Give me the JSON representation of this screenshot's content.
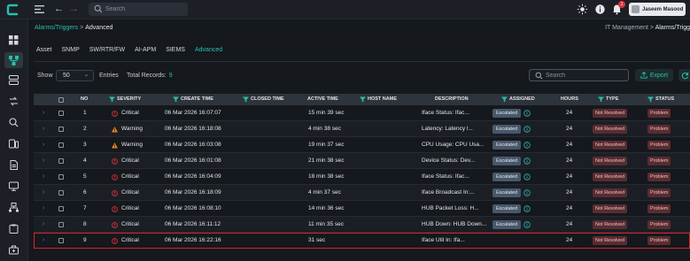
{
  "topbar": {
    "search_placeholder": "Search",
    "notification_count": "1",
    "user_name": "Jaseem Masood"
  },
  "breadcrumb": {
    "parent": "Alarms/Triggers",
    "separator": ">",
    "current": "Advanced",
    "right_prefix": "IT Management",
    "right_sep": ">",
    "right_current": "Alarms/Trigg"
  },
  "tabs": [
    {
      "label": "Asset"
    },
    {
      "label": "SNMP"
    },
    {
      "label": "SW/RTR/FW"
    },
    {
      "label": "AI-APM"
    },
    {
      "label": "SIEMS"
    },
    {
      "label": "Advanced"
    }
  ],
  "controls": {
    "show_label": "Show",
    "show_value": "50",
    "entries_label": "Entries",
    "records_label": "Total Records:",
    "records_value": "9",
    "search_placeholder": "Search",
    "export_label": "Export"
  },
  "columns": {
    "no": "NO",
    "severity": "SEVERITY",
    "create_time": "CREATE TIME",
    "closed_time": "CLOSED TIME",
    "active_time": "ACTIVE TIME",
    "host_name": "HOST NAME",
    "description": "DESCRIPTION",
    "assigned": "ASSIGNED",
    "hours": "HOURS",
    "type": "TYPE",
    "status": "STATUS"
  },
  "colors": {
    "accent": "#27c0ad",
    "critical": "#e0323a",
    "warning": "#f08a24",
    "highlight_border": "#d7232c"
  },
  "rows": [
    {
      "no": "1",
      "severity": "Critical",
      "severity_icon": "critical-circle-icon",
      "create_time": "06 Mar 2026 16:07:07",
      "closed_time": "",
      "active_time": "15 min 39 sec",
      "host_name": "",
      "description": "Iface Status: Ifac...",
      "assigned": "Escalated",
      "hours": "24",
      "type": "Not Resolved",
      "status": "Problem"
    },
    {
      "no": "2",
      "severity": "Warning",
      "severity_icon": "warning-triangle-icon",
      "create_time": "06 Mar 2026 16:18:08",
      "closed_time": "",
      "active_time": "4 min 38 sec",
      "host_name": "",
      "description": "Latency: Latency l...",
      "assigned": "Escalated",
      "hours": "24",
      "type": "Not Resolved",
      "status": "Problem"
    },
    {
      "no": "3",
      "severity": "Warning",
      "severity_icon": "warning-triangle-icon",
      "create_time": "06 Mar 2026 16:03:08",
      "closed_time": "",
      "active_time": "19 min 37 sec",
      "host_name": "",
      "description": "CPU Usage: CPU Usa...",
      "assigned": "Escalated",
      "hours": "24",
      "type": "Not Resolved",
      "status": "Problem"
    },
    {
      "no": "4",
      "severity": "Critical",
      "severity_icon": "critical-circle-icon",
      "create_time": "06 Mar 2026 16:01:08",
      "closed_time": "",
      "active_time": "21 min 38 sec",
      "host_name": "",
      "description": "Device Status: Dev...",
      "assigned": "Escalated",
      "hours": "24",
      "type": "Not Resolved",
      "status": "Problem"
    },
    {
      "no": "5",
      "severity": "Critical",
      "severity_icon": "critical-circle-icon",
      "create_time": "06 Mar 2026 16:04:09",
      "closed_time": "",
      "active_time": "18 min 38 sec",
      "host_name": "",
      "description": "Iface Status: Ifac...",
      "assigned": "Escalated",
      "hours": "24",
      "type": "Not Resolved",
      "status": "Problem"
    },
    {
      "no": "6",
      "severity": "Critical",
      "severity_icon": "critical-circle-icon",
      "create_time": "06 Mar 2026 16:18:09",
      "closed_time": "",
      "active_time": "4 min 37 sec",
      "host_name": "",
      "description": "Iface Broadcast In:...",
      "assigned": "Escalated",
      "hours": "24",
      "type": "Not Resolved",
      "status": "Problem"
    },
    {
      "no": "7",
      "severity": "Critical",
      "severity_icon": "critical-circle-icon",
      "create_time": "06 Mar 2026 16:08:10",
      "closed_time": "",
      "active_time": "14 min 36 sec",
      "host_name": "",
      "description": "HUB Packet Loss: H...",
      "assigned": "Escalated",
      "hours": "24",
      "type": "Not Resolved",
      "status": "Problem"
    },
    {
      "no": "8",
      "severity": "Critical",
      "severity_icon": "critical-circle-icon",
      "create_time": "06 Mar 2026 16:11:12",
      "closed_time": "",
      "active_time": "11 min 35 sec",
      "host_name": "",
      "description": "HUB Down: HUB Down...",
      "assigned": "Escalated",
      "hours": "24",
      "type": "Not Resolved",
      "status": "Problem"
    },
    {
      "no": "9",
      "severity": "Critical",
      "severity_icon": "critical-circle-icon",
      "create_time": "06 Mar 2026 16:22:16",
      "closed_time": "",
      "active_time": "31 sec",
      "host_name": "",
      "description": "Iface Util In: Ifa...",
      "assigned": "",
      "hours": "24",
      "type": "Not Resolved",
      "status": "Problem"
    }
  ]
}
